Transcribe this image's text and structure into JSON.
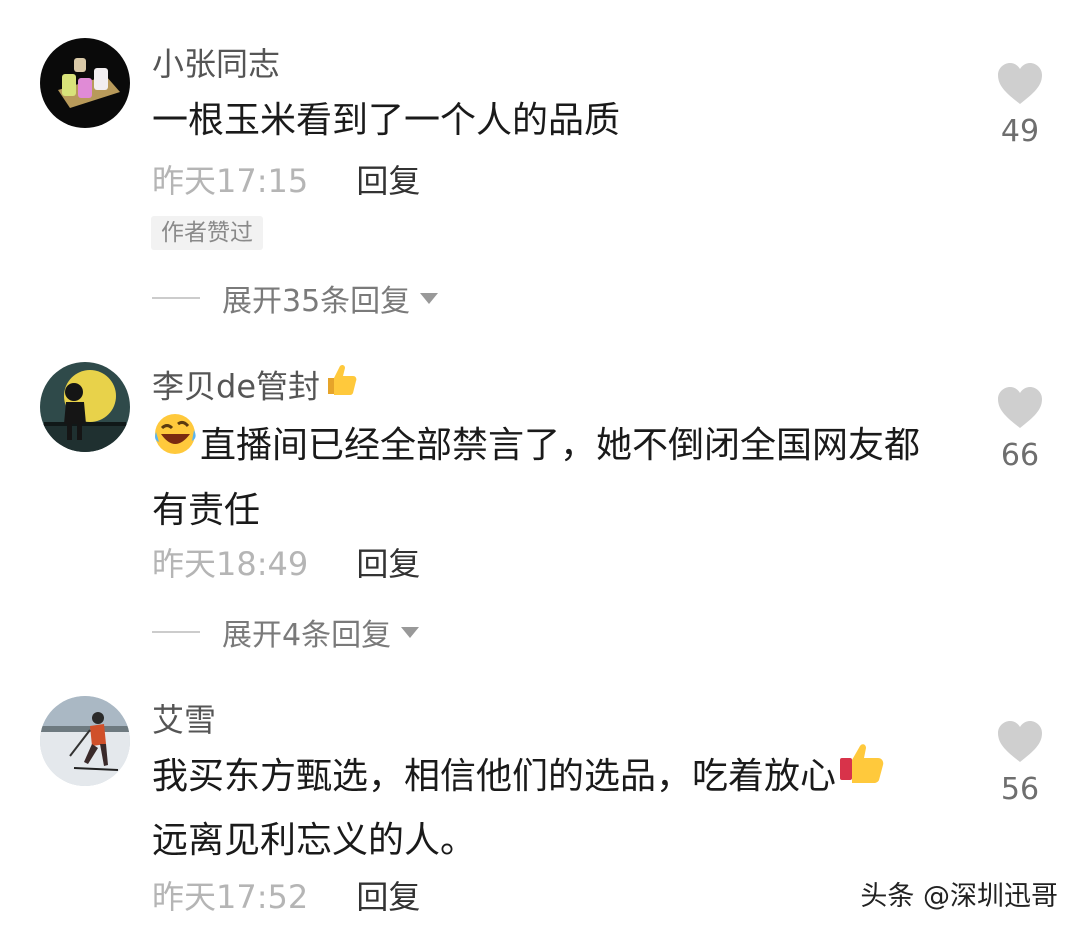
{
  "comments": [
    {
      "avatar_icon": "candles-avatar-icon",
      "username": "小张同志",
      "username_icon": "",
      "content_lead_icon": "",
      "content_lines": [
        "一根玉米看到了一个人的品质"
      ],
      "time": "昨天17:15",
      "reply_label": "回复",
      "badge": "作者赞过",
      "expand_label": "展开35条回复",
      "like_count": "49"
    },
    {
      "avatar_icon": "moon-silhouette-avatar-icon",
      "username": "李贝de管封",
      "username_icon": "thumbs-up-emoji-icon",
      "content_lead_icon": "laughing-face-emoji-icon",
      "content_lines": [
        "直播间已经全部禁言了，她不倒闭全国网友都",
        "有责任"
      ],
      "time": "昨天18:49",
      "reply_label": "回复",
      "badge": "",
      "expand_label": "展开4条回复",
      "like_count": "66"
    },
    {
      "avatar_icon": "skier-avatar-icon",
      "username": "艾雪",
      "username_icon": "",
      "content_lead_icon": "",
      "content_lines": [
        "我买东方甄选，相信他们的选品，吃着放心",
        "远离见利忘义的人。"
      ],
      "content_trail_icon": "thumbs-up-emoji-icon",
      "time": "昨天17:52",
      "reply_label": "回复",
      "badge": "",
      "expand_label": "",
      "like_count": "56"
    }
  ],
  "watermark": "头条 @深圳迅哥",
  "colors": {
    "username": "#555555",
    "time": "#b5b5b5",
    "heart": "#cfcfcf",
    "badge_bg": "#f2f2f2"
  }
}
